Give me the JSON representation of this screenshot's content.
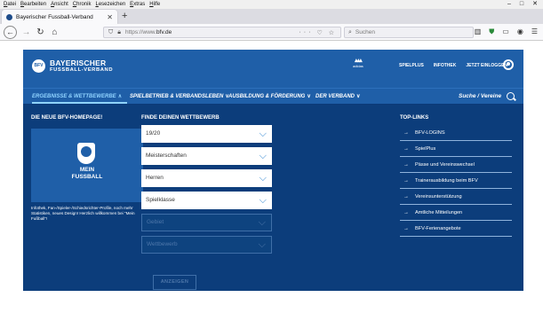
{
  "browser": {
    "menu": [
      "Datei",
      "Bearbeiten",
      "Ansicht",
      "Chronik",
      "Lesezeichen",
      "Extras",
      "Hilfe"
    ],
    "tab_title": "Bayerischer Fussball-Verband",
    "url_prefix": "https://www.",
    "url_domain": "bfv.de",
    "search_placeholder": "Suchen"
  },
  "site": {
    "logo_line1": "BAYERISCHER",
    "logo_line2": "FUSSBALL-VERBAND",
    "logo_mark": "BFV",
    "sponsor": "adidas",
    "top_links": [
      "SPIELPLUS",
      "INFOTHEK",
      "JETZT EINLOGGEN"
    ],
    "nav": [
      {
        "label": "ERGEBNISSE & WETTBEWERBE",
        "active": true
      },
      {
        "label": "SPIELBETRIEB & VERBANDSLEBEN",
        "active": false
      },
      {
        "label": "AUSBILDUNG & FÖRDERUNG",
        "active": false
      },
      {
        "label": "DER VERBAND",
        "active": false
      }
    ],
    "nav_search": "Suche / Vereine"
  },
  "promo": {
    "heading": "DIE NEUE BFV-HOMEPAGE!",
    "caption_line1": "MEIN",
    "caption_line2": "FUSSBALL",
    "text": "Infothek, Fan-/Spieler-/Schiedsrichter-Profile, noch mehr Statistiken, neues Design! Herzlich willkommen bei \"Mein Fußball\"!"
  },
  "finder": {
    "heading": "FINDE DEINEN WETTBEWERB",
    "fields": [
      {
        "value": "19/20",
        "disabled": false
      },
      {
        "value": "Meisterschaften",
        "disabled": false
      },
      {
        "value": "Herren",
        "disabled": false
      },
      {
        "value": "Spielklasse",
        "disabled": false
      },
      {
        "value": "Gebiet",
        "disabled": true
      },
      {
        "value": "Wettbewerb",
        "disabled": true
      }
    ],
    "submit": "ANZEIGEN"
  },
  "toplinks": {
    "heading": "TOP-LINKS",
    "items": [
      "BFV-LOGINS",
      "SpielPlus",
      "Pässe und Vereinswechsel",
      "Trainerausbildung beim BFV",
      "Vereinsunterstützung",
      "Amtliche Mitteilungen",
      "BFV-Ferienangebote"
    ]
  }
}
